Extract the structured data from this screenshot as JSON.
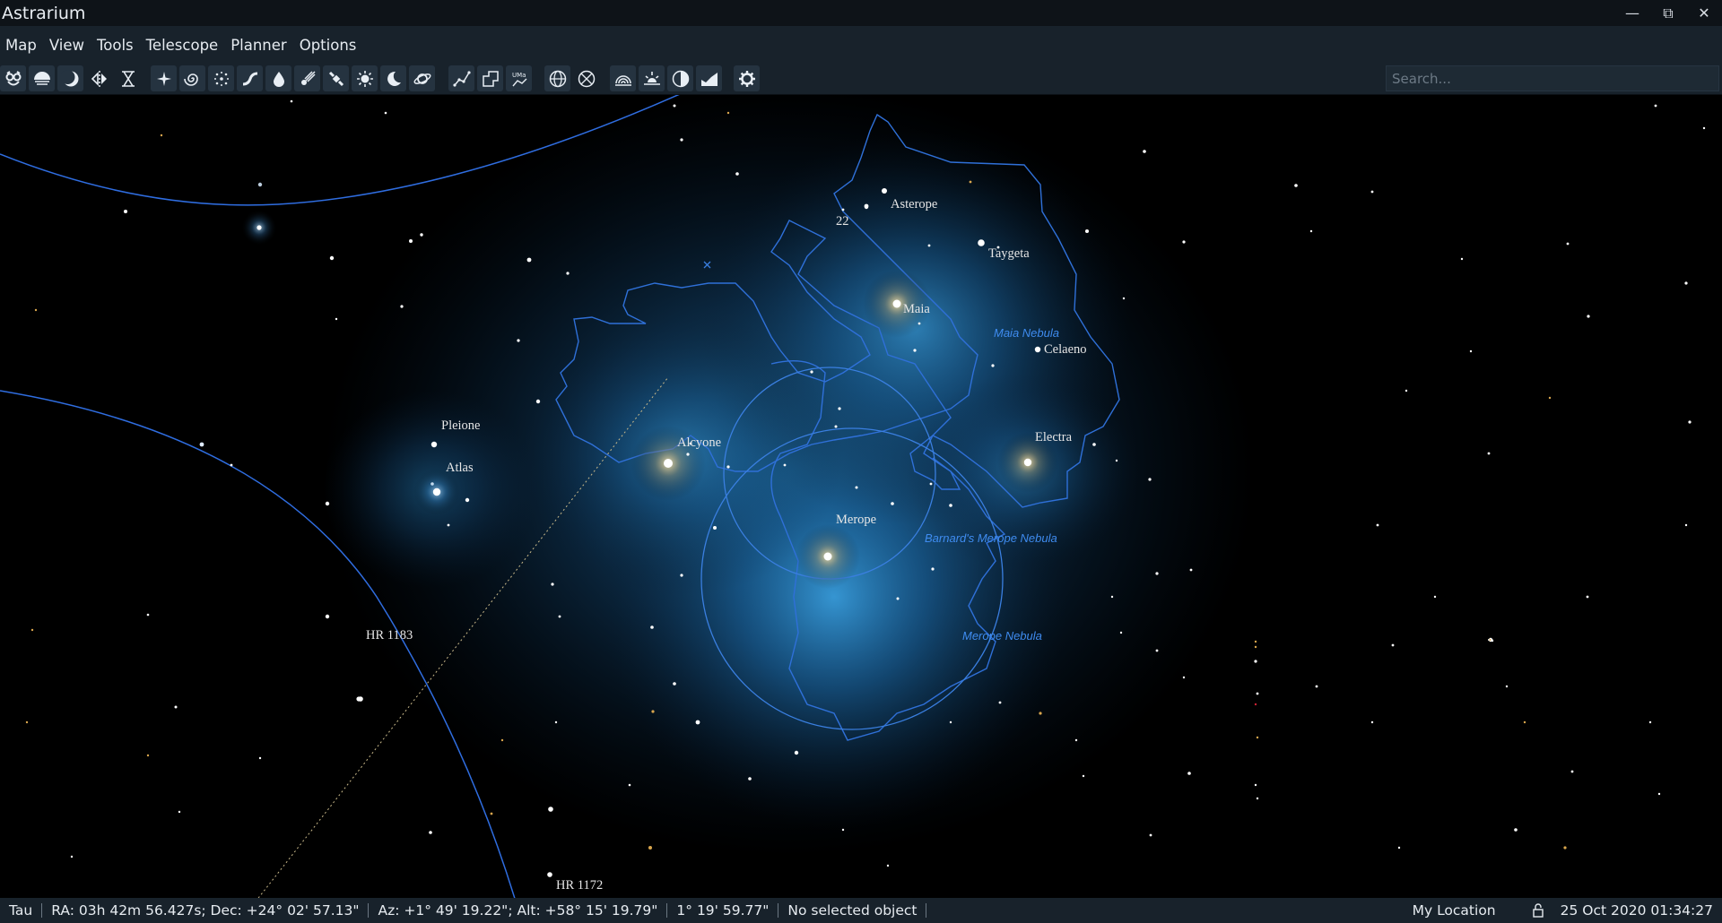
{
  "window": {
    "title": "Astrarium",
    "minimize": "—",
    "restore": "⧉",
    "close": "✕"
  },
  "menu": [
    "Map",
    "View",
    "Tools",
    "Telescope",
    "Planner",
    "Options"
  ],
  "toolbar": {
    "groups": [
      [
        "owl-icon",
        "ground-icon",
        "moon-phase-icon",
        "mirror-icon",
        "hourglass-icon"
      ],
      [
        "stars-icon",
        "galaxy-icon",
        "cluster-icon",
        "milky-way-icon",
        "drop-icon",
        "comet-icon",
        "satellite-icon",
        "sun-icon",
        "crescent-icon",
        "planet-icon"
      ],
      [
        "constellation-lines-icon",
        "constellation-borders-icon",
        "constellation-labels-icon"
      ],
      [
        "equatorial-grid-icon",
        "horizontal-grid-icon"
      ],
      [
        "horizon-icon",
        "sunrise-icon",
        "lunar-eclipse-icon",
        "landscape-icon"
      ],
      [
        "settings-icon"
      ]
    ],
    "search_placeholder": "Search..."
  },
  "sky": {
    "star_labels": [
      "Asterope",
      "22",
      "Taygeta",
      "Maia",
      "Celaeno",
      "Pleione",
      "Alcyone",
      "Electra",
      "Atlas",
      "Merope",
      "HR 1183",
      "HR 1172"
    ],
    "nebula_labels": [
      "Maia Nebula",
      "Barnard's Merope Nebula",
      "Merope Nebula"
    ],
    "colors": {
      "grid_line": "#2f6de0",
      "nebula_label": "#3f8cf0",
      "star_label": "#e6e6e6",
      "nebula_glow": "#1f7fc0"
    }
  },
  "status": {
    "constellation": "Tau",
    "equatorial": "RA: 03h 42m 56.427s; Dec: +24° 02' 57.13\"",
    "horizontal": "Az: +1° 49' 19.22\"; Alt: +58° 15' 19.79\"",
    "fov": "1° 19' 59.77\"",
    "selection": "No selected object",
    "location": "My Location",
    "datetime": "25 Oct 2020 01:34:27"
  }
}
